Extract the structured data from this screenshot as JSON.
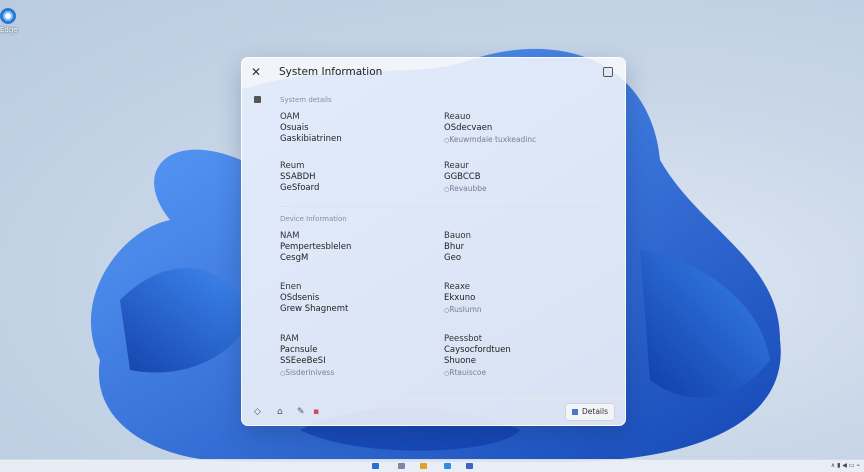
{
  "desktop": {
    "icon_label": "Edge"
  },
  "window": {
    "title": "System Information",
    "section1": "System details",
    "section2": "Device Information",
    "cells": [
      {
        "h": "OAM",
        "l1": "Osuais",
        "l2": "Gaskibiatrinen",
        "sub": ""
      },
      {
        "h": "Reauo",
        "l1": "OSdecvaen",
        "l2": "",
        "sub": "Keuwmdaie tuxkeadinc"
      },
      {
        "h": "Reum",
        "l1": "SSABDH",
        "l2": "GeSfoard",
        "sub": ""
      },
      {
        "h": "Reaur",
        "l1": "GGBCCB",
        "l2": "",
        "sub": "Revaubbe"
      },
      {
        "h": "NAM",
        "l1": "Pempertesblelen",
        "l2": "CesgM",
        "sub": ""
      },
      {
        "h": "Bauon",
        "l1": "Bhur",
        "l2": "Geo",
        "sub": ""
      },
      {
        "h": "Enen",
        "l1": "OSdsenis",
        "l2": "Grew Shagnemt",
        "sub": ""
      },
      {
        "h": "Reaxe",
        "l1": "Ekxuno",
        "l2": "",
        "sub": "Ruslumn"
      },
      {
        "h": "RAM",
        "l1": "Pacnsule",
        "l2": "SSEeeBeSI",
        "sub": "Sisderinivess"
      },
      {
        "h": "Peessbot",
        "l1": "Caysocfordtuen",
        "l2": "Shuone",
        "sub": "Rtauiscoe"
      }
    ],
    "footer_button": "Details"
  },
  "colors": {
    "accent": "#2a6fd6",
    "bloom": "#1f63d8"
  }
}
